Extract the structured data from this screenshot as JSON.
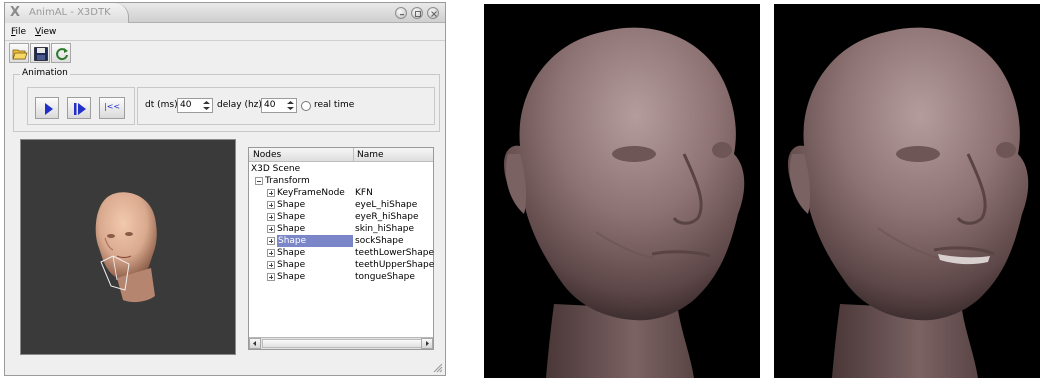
{
  "window": {
    "title": "AnimAL - X3DTK"
  },
  "menu": {
    "items": [
      "File",
      "View"
    ]
  },
  "toolbar": {
    "icons": [
      "open-folder-icon",
      "save-disk-icon",
      "reload-icon"
    ]
  },
  "animation": {
    "group_title": "Animation",
    "play_label": "play",
    "step_label": "step",
    "reset_label": "|<<",
    "dt_label": "dt (ms)",
    "dt_value": "40",
    "delay_label": "delay (hz)",
    "delay_value": "40",
    "realtime_label": "real time",
    "realtime_checked": false
  },
  "tree": {
    "columns": [
      "Nodes",
      "Name"
    ],
    "root": "X3D Scene",
    "transform": "Transform",
    "rows": [
      {
        "node": "KeyFrameNode",
        "name": "KFN"
      },
      {
        "node": "Shape",
        "name": "eyeL_hiShape"
      },
      {
        "node": "Shape",
        "name": "eyeR_hiShape"
      },
      {
        "node": "Shape",
        "name": "skin_hiShape"
      },
      {
        "node": "Shape",
        "name": "sockShape"
      },
      {
        "node": "Shape",
        "name": "teethLowerShape"
      },
      {
        "node": "Shape",
        "name": "teethUpperShape"
      },
      {
        "node": "Shape",
        "name": "tongueShape"
      }
    ],
    "selected_index": 4
  },
  "colors": {
    "viewport_bg": "#3a3a3a",
    "selection": "#7b86c8",
    "head_skin_small": "#d9a98e",
    "head_skin_render": "#8a6f70",
    "play_icon": "#2030c8"
  }
}
